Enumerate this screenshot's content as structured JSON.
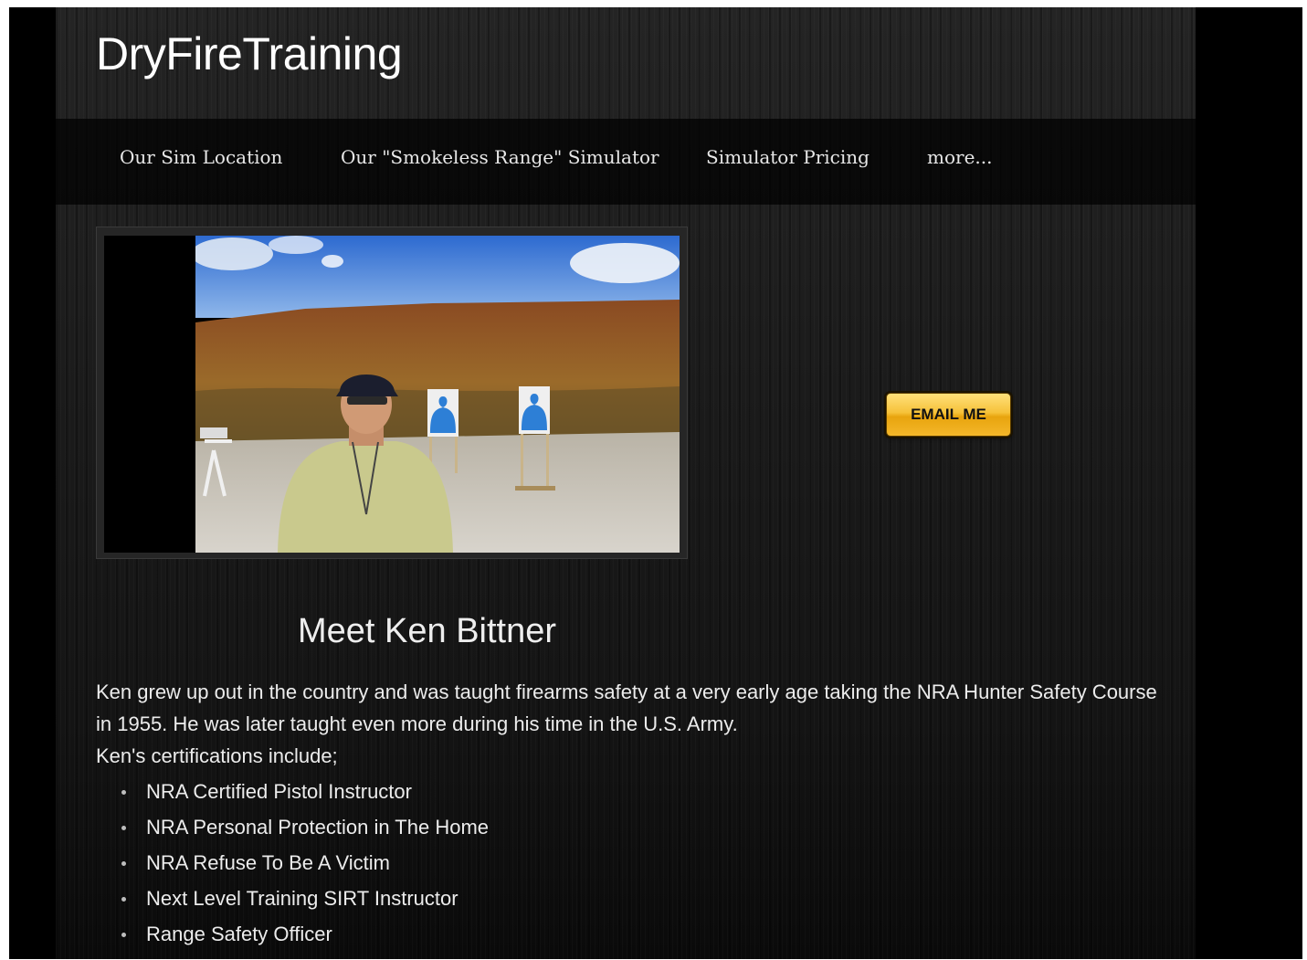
{
  "site": {
    "title": "DryFireTraining"
  },
  "nav": {
    "items": [
      {
        "label": "Our Sim Location"
      },
      {
        "label": "Our \"Smokeless Range\" Simulator"
      },
      {
        "label": "Simulator Pricing"
      },
      {
        "label": "more..."
      }
    ]
  },
  "contact": {
    "email_button_label": "EMAIL ME",
    "accent_color": "#f6c23a"
  },
  "profile": {
    "heading": "Meet Ken Bittner",
    "bio_line1": "Ken grew up out in the country and was taught firearms safety at a very early age taking the NRA Hunter Safety Course in 1955.  He was later taught even more during his time in the U.S. Army.",
    "bio_line2": "Ken's certifications include;",
    "certifications": [
      "NRA Certified Pistol Instructor",
      "NRA Personal Protection in The Home",
      "NRA Refuse To Be A Victim",
      "Next Level Training SIRT Instructor",
      "Range Safety Officer"
    ]
  }
}
